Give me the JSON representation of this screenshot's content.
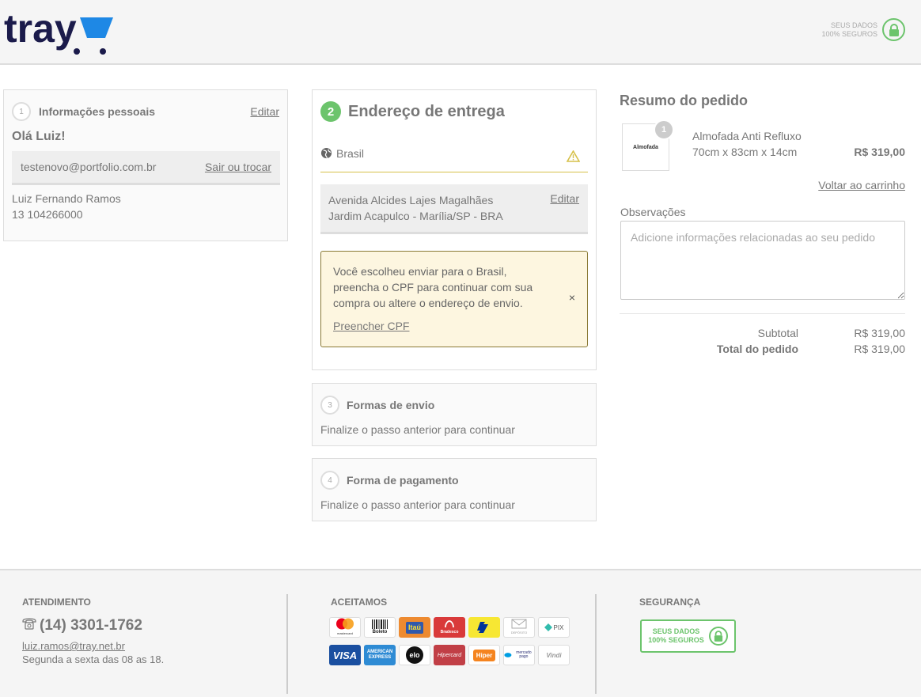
{
  "header": {
    "logo_text": "tray",
    "secure_line1": "SEUS DADOS",
    "secure_line2": "100% SEGUROS"
  },
  "step1": {
    "number": "1",
    "title": "Informações pessoais",
    "edit_label": "Editar",
    "greeting": "Olá Luiz!",
    "email": "testenovo@portfolio.com.br",
    "switch_label": "Sair ou trocar",
    "name": "Luiz Fernando Ramos",
    "phone": "13 104266000"
  },
  "step2": {
    "number": "2",
    "title": "Endereço de entrega",
    "country": "Brasil",
    "address_line1": "Avenida Alcides Lajes Magalhães",
    "address_line2": "Jardim Acapulco - Marília/SP - BRA",
    "edit_label": "Editar",
    "alert_message": "Você escolheu enviar para o Brasil, preencha o CPF para continuar com sua compra ou altere o endereço de envio.",
    "alert_link": "Preencher CPF",
    "alert_close": "×"
  },
  "step3": {
    "number": "3",
    "title": "Formas de envio",
    "subtitle": "Finalize o passo anterior para continuar"
  },
  "step4": {
    "number": "4",
    "title": "Forma de pagamento",
    "subtitle": "Finalize o passo anterior para continuar"
  },
  "summary": {
    "title": "Resumo do pedido",
    "product_thumb_text": "Almofada",
    "product_qty": "1",
    "product_name": "Almofada Anti Refluxo",
    "product_size": "70cm x 83cm x 14cm",
    "product_price": "R$ 319,00",
    "back_to_cart": "Voltar ao carrinho",
    "obs_label": "Observações",
    "obs_placeholder": "Adicione informações relacionadas ao seu pedido",
    "subtotal_label": "Subtotal",
    "subtotal_value": "R$ 319,00",
    "total_label": "Total do pedido",
    "total_value": "R$ 319,00"
  },
  "footer": {
    "support_title": "ATENDIMENTO",
    "phone": "(14) 3301-1762",
    "email": "luiz.ramos@tray.net.br",
    "hours": "Segunda a sexta das 08 as 18.",
    "accept_title": "ACEITAMOS",
    "payment_methods": [
      "mastercard",
      "Boleto",
      "Itaú",
      "Bradesco",
      "Banco do Brasil",
      "DEPÓSITO",
      "PIX",
      "VISA",
      "AMERICAN EXPRESS",
      "elo",
      "Hipercard",
      "Hiper",
      "mercado pago",
      "Vindi"
    ],
    "security_title": "SEGURANÇA",
    "secure_line1": "SEUS DADOS",
    "secure_line2": "100% SEGUROS"
  },
  "colors": {
    "green": "#6cc46c",
    "logo_navy": "#1b1b4b",
    "logo_blue": "#1e88e5",
    "alert_bg": "#fdf6e0",
    "warning": "#d6c14a"
  }
}
